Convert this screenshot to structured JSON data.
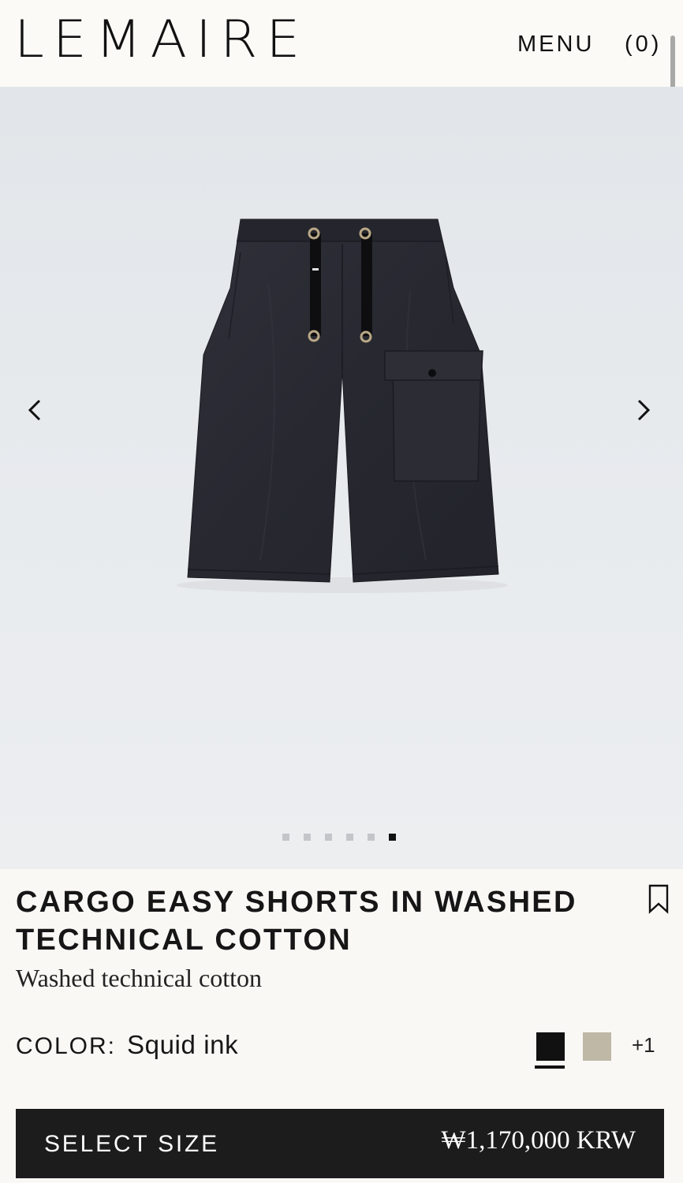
{
  "header": {
    "logo": "LEMAIRE",
    "menu_label": "MENU",
    "cart_label": "(0)"
  },
  "gallery": {
    "prev_icon": "chevron-left-icon",
    "next_icon": "chevron-right-icon",
    "image_count": 6,
    "active_index": 5
  },
  "product": {
    "title": "CARGO EASY SHORTS IN WASHED TECHNICAL COTTON",
    "subtitle": "Washed technical cotton",
    "bookmark_icon": "bookmark-icon",
    "color_label": "COLOR:",
    "color_value": "Squid ink",
    "swatches": [
      {
        "name": "Squid ink",
        "hex": "#111111",
        "selected": true
      },
      {
        "name": "Sand",
        "hex": "#bfb8a6",
        "selected": false
      }
    ],
    "more_colors": "+1",
    "cta_label": "SELECT SIZE",
    "price": "₩1,170,000 KRW"
  },
  "colors": {
    "background": "#f9f8f5",
    "cta_background": "#1c1c1c",
    "product_fabric": "#2a2b33"
  }
}
